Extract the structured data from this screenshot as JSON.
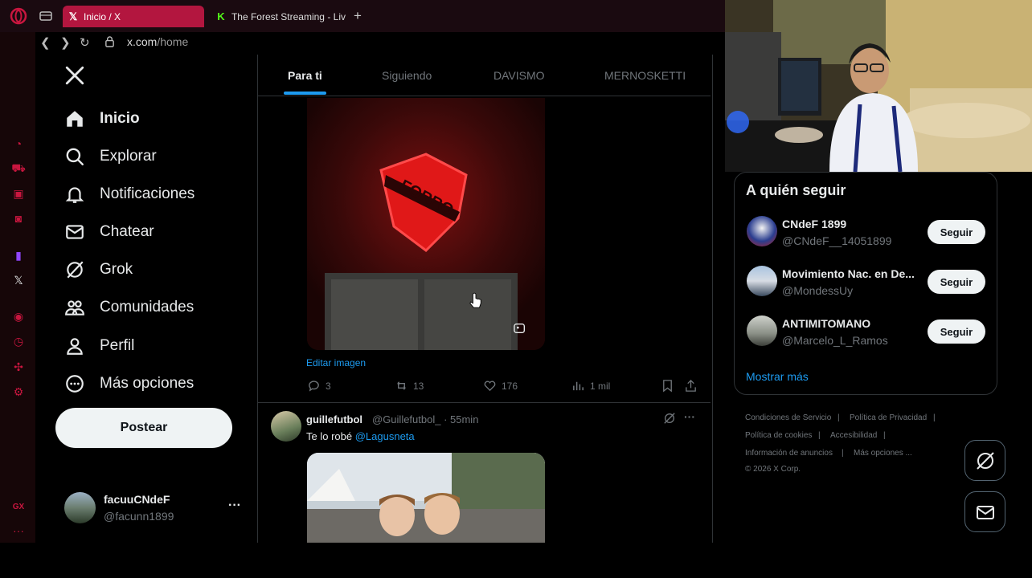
{
  "browser": {
    "tabs": [
      {
        "label": "Inicio / X",
        "active": true
      },
      {
        "label": "The Forest Streaming - Liv",
        "active": false
      }
    ],
    "new_tab_symbol": "+",
    "url_domain": "x.com",
    "url_path": "/home"
  },
  "nav": {
    "items": [
      {
        "label": "Inicio",
        "icon": "home-icon"
      },
      {
        "label": "Explorar",
        "icon": "search-icon"
      },
      {
        "label": "Notificaciones",
        "icon": "bell-icon"
      },
      {
        "label": "Chatear",
        "icon": "mail-icon"
      },
      {
        "label": "Grok",
        "icon": "grok-icon"
      },
      {
        "label": "Comunidades",
        "icon": "communities-icon"
      },
      {
        "label": "Perfil",
        "icon": "person-icon"
      },
      {
        "label": "Más opciones",
        "icon": "more-circle-icon"
      }
    ],
    "post_label": "Postear"
  },
  "account": {
    "name": "facuuCNdeF",
    "handle": "@facunn1899",
    "more": "···"
  },
  "feed_tabs": [
    "Para ti",
    "Siguiendo",
    "DAVISMO",
    "MERNOSKETTI"
  ],
  "post1": {
    "image_text": "FORRO",
    "edit_image_label": "Editar imagen",
    "replies": "3",
    "reposts": "13",
    "likes": "176",
    "views": "1 mil"
  },
  "post2": {
    "author": "guillefutbol",
    "handle_time": "@Guillefutbol_ · 55min",
    "text": "Te lo robé",
    "mention": "@Lagusneta",
    "more": "···"
  },
  "who_to_follow": {
    "title": "A quién seguir",
    "items": [
      {
        "name": "CNdeF 1899",
        "handle": "@CNdeF__14051899",
        "button": "Seguir"
      },
      {
        "name": "Movimiento Nac. en De...",
        "handle": "@MondessUy",
        "button": "Seguir"
      },
      {
        "name": "ANTIMITOMANO",
        "handle": "@Marcelo_L_Ramos",
        "button": "Seguir"
      }
    ],
    "show_more": "Mostrar más"
  },
  "footer": {
    "links": [
      "Condiciones de Servicio",
      "Política de Privacidad",
      "Política de cookies",
      "Accesibilidad",
      "Información de anuncios",
      "Más opciones ..."
    ],
    "separator": "|",
    "copyright": "© 2026 X Corp."
  },
  "colors": {
    "accent": "#1d9bf0",
    "opera_red": "#c9163f",
    "tab_active": "#b3163f"
  }
}
